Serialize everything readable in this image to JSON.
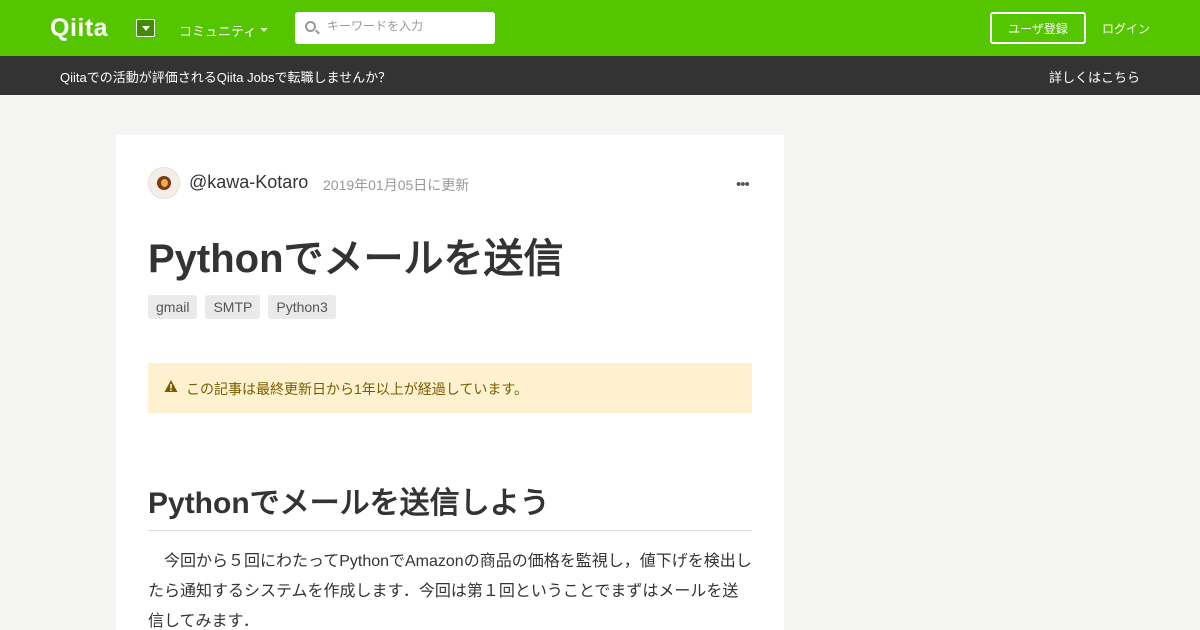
{
  "header": {
    "logo": "Qiita",
    "community_label": "コミュニティ",
    "search_placeholder": "キーワードを入力",
    "signup_label": "ユーザ登録",
    "login_label": "ログイン"
  },
  "banner": {
    "text": "Qiitaでの活動が評価されるQiita Jobsで転職しませんか？",
    "link": "詳しくはこちら"
  },
  "article": {
    "author": "@kawa-Kotaro",
    "updated": "2019年01月05日に更新",
    "more": "•••",
    "title": "Pythonでメールを送信",
    "tags": [
      "gmail",
      "SMTP",
      "Python3"
    ],
    "notice": "この記事は最終更新日から1年以上が経過しています。",
    "heading": "Pythonでメールを送信しよう",
    "paragraph": "今回から５回にわたってPythonでAmazonの商品の価格を監視し，値下げを検出したら通知するシステムを作成します．今回は第１回ということでまずはメールを送信してみます．"
  }
}
